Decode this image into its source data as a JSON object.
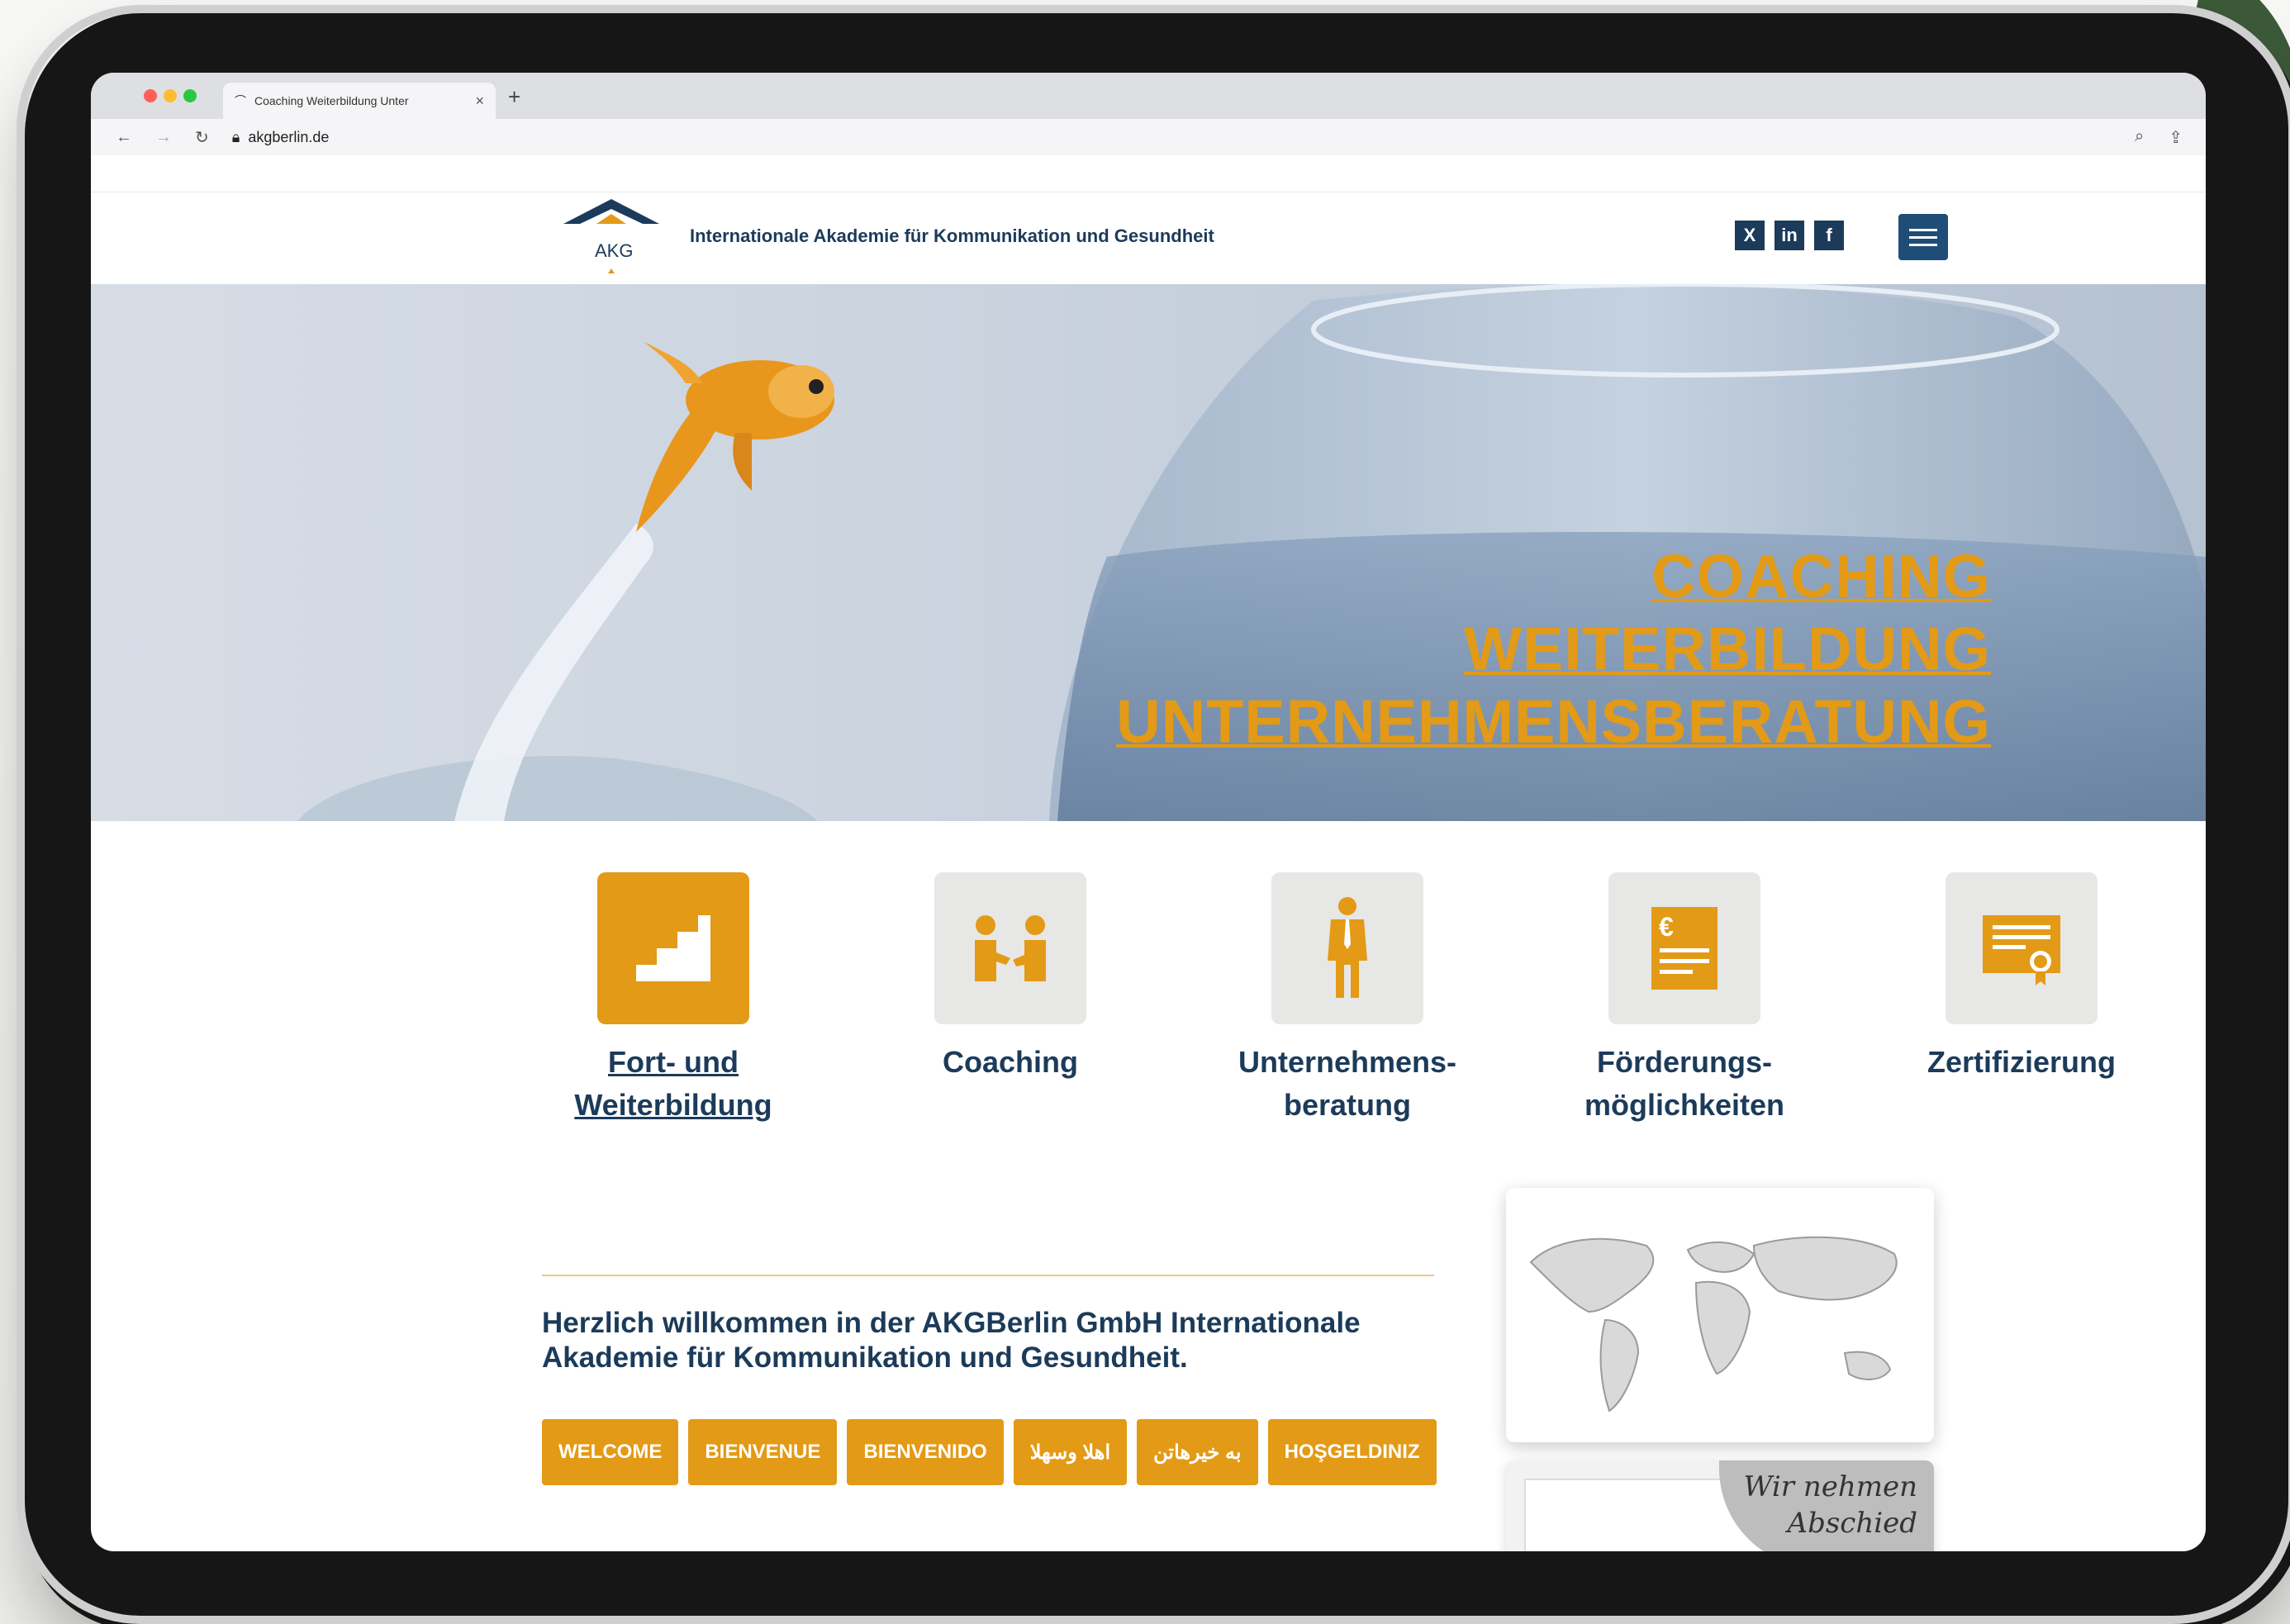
{
  "browser": {
    "tab_title": "Coaching Weiterbildung Unter",
    "url": "akgberlin.de"
  },
  "site": {
    "logo_text": "AKG",
    "tagline": "Internationale Akademie für Kommunikation und Gesundheit",
    "social": [
      "X",
      "in",
      "f"
    ]
  },
  "hero": {
    "headline_1": "COACHING",
    "headline_2": "WEITERBILDUNG",
    "headline_3": "UNTERNEHMENSBERATUNG"
  },
  "categories": [
    {
      "line1": "Fort- und",
      "line2": "Weiterbildung",
      "icon": "stairs-icon"
    },
    {
      "line1": "Coaching",
      "line2": "",
      "icon": "handshake-icon"
    },
    {
      "line1": "Unternehmens-",
      "line2": "beratung",
      "icon": "businessman-icon"
    },
    {
      "line1": "Förderungs-",
      "line2": "möglichkeiten",
      "icon": "euro-document-icon"
    },
    {
      "line1": "Zertifizierung",
      "line2": "",
      "icon": "certificate-icon"
    }
  ],
  "welcome": {
    "text": "Herzlich willkommen in der AKGBerlin GmbH Internationale Akademie für Kommunikation und Gesundheit."
  },
  "languages": [
    "WELCOME",
    "BIENVENUE",
    "BIENVENIDO",
    "اهلا وسهلا",
    "به خیرهاتن",
    "HOŞGELDINIZ"
  ],
  "note": {
    "line1": "Wir nehmen",
    "line2": "Abschied"
  },
  "colors": {
    "accent": "#e39a16",
    "navy": "#1c3b5a"
  }
}
